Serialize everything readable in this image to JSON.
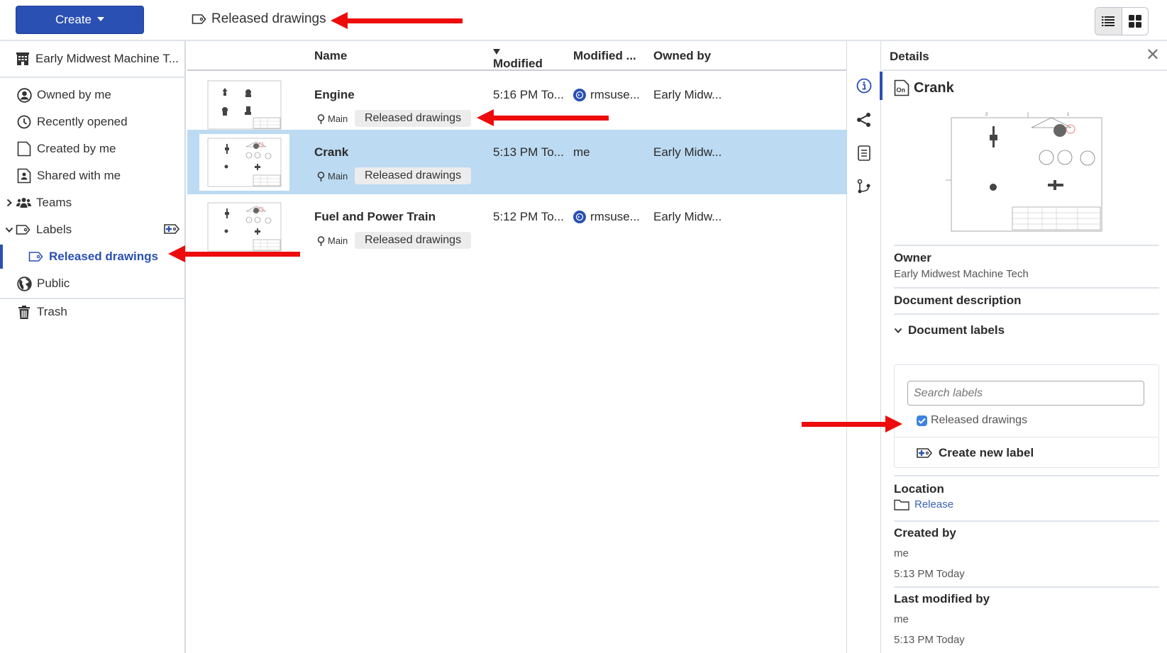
{
  "topbar": {
    "create_label": "Create",
    "breadcrumb": "Released drawings",
    "view_modes": [
      "list-view",
      "grid-view"
    ],
    "active_view": "list-view"
  },
  "sidebar": {
    "org": "Early Midwest Machine T...",
    "items": [
      {
        "label": "Owned by me",
        "icon": "user-circle-icon"
      },
      {
        "label": "Recently opened",
        "icon": "clock-icon"
      },
      {
        "label": "Created by me",
        "icon": "document-icon"
      },
      {
        "label": "Shared with me",
        "icon": "shared-document-icon"
      },
      {
        "label": "Teams",
        "icon": "team-icon"
      },
      {
        "label": "Labels",
        "icon": "label-icon"
      },
      {
        "label": "Released drawings",
        "icon": "label-icon"
      },
      {
        "label": "Public",
        "icon": "globe-icon"
      },
      {
        "label": "Trash",
        "icon": "trash-icon"
      }
    ],
    "selected": "Released drawings"
  },
  "table": {
    "columns": [
      "Name",
      "Modified",
      "Modified ...",
      "Owned by"
    ],
    "sort_column": "Modified",
    "sort_direction": "desc",
    "rows": [
      {
        "name": "Engine",
        "branch": "Main",
        "label": "Released drawings",
        "modified": "5:16 PM To...",
        "modified_by": "rmsuse...",
        "modified_by_avatar": true,
        "owner": "Early Midw...",
        "selected": false
      },
      {
        "name": "Crank",
        "branch": "Main",
        "label": "Released drawings",
        "modified": "5:13 PM To...",
        "modified_by": "me",
        "modified_by_avatar": false,
        "owner": "Early Midw...",
        "selected": true
      },
      {
        "name": "Fuel and Power Train",
        "branch": "Main",
        "label": "Released drawings",
        "modified": "5:12 PM To...",
        "modified_by": "rmsuse...",
        "modified_by_avatar": true,
        "owner": "Early Midw...",
        "selected": false
      }
    ]
  },
  "rail": {
    "items": [
      "info-icon",
      "share-icon",
      "document-list-icon",
      "branch-icon"
    ],
    "active": "info-icon"
  },
  "details": {
    "header": "Details",
    "doc_title": "Crank",
    "owner_heading": "Owner",
    "owner_value": "Early Midwest Machine Tech",
    "description_heading": "Document description",
    "labels_heading": "Document labels",
    "search_placeholder": "Search labels",
    "label_option": "Released drawings",
    "label_checked": true,
    "create_label": "Create new label",
    "location_heading": "Location",
    "location_value": "Release",
    "created_heading": "Created by",
    "created_by": "me",
    "created_time": "5:13 PM Today",
    "modified_heading": "Last modified by",
    "modified_by": "me",
    "modified_time": "5:13 PM Today"
  },
  "colors": {
    "accent": "#2a50b3",
    "selected_row": "#bcdaf1",
    "annotation_arrow": "#ee0b0b",
    "checkbox": "#3d83e0"
  }
}
